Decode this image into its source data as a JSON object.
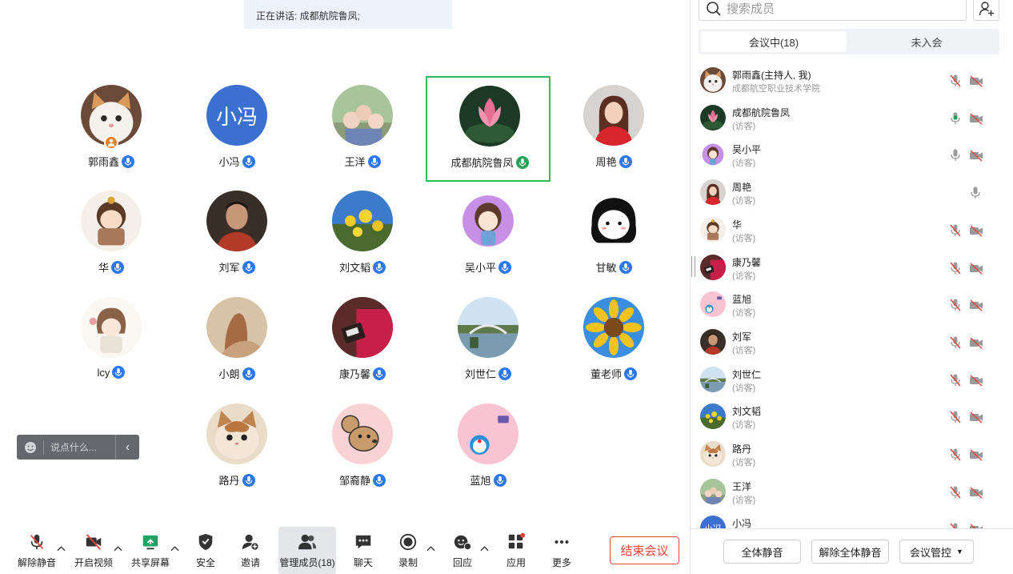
{
  "speaking_banner": "正在讲话: 成都航院鲁凤;",
  "grid": [
    {
      "name": "郭雨鑫",
      "avatar": "cat-avatar",
      "host": true,
      "mic": "blue"
    },
    {
      "name": "小冯",
      "avatar": "text-avatar",
      "avatar_text": "小冯",
      "mic": "blue"
    },
    {
      "name": "王洋",
      "avatar": "family-photo-avatar",
      "mic": "blue"
    },
    {
      "name": "成都航院鲁凤",
      "avatar": "lotus-avatar",
      "mic": "green",
      "active": true
    },
    {
      "name": "周艳",
      "avatar": "woman-red-avatar",
      "mic": "blue"
    },
    {
      "name": "华",
      "avatar": "cartoon-girl-avatar",
      "mic": "blue"
    },
    {
      "name": "刘军",
      "avatar": "man-portrait-avatar",
      "mic": "blue"
    },
    {
      "name": "刘文韬",
      "avatar": "yellow-flowers-avatar",
      "mic": "blue"
    },
    {
      "name": "吴小平",
      "avatar": "purple-girl-avatar",
      "mic": "blue"
    },
    {
      "name": "甘敏",
      "avatar": "black-hair-face-avatar",
      "mic": "blue"
    },
    {
      "name": "lcy",
      "avatar": "sketch-girl-avatar",
      "mic": "blue"
    },
    {
      "name": "小朗",
      "avatar": "sand-hand-avatar",
      "mic": "blue"
    },
    {
      "name": "康乃馨",
      "avatar": "red-bag-avatar",
      "mic": "blue"
    },
    {
      "name": "刘世仁",
      "avatar": "bridge-landscape-avatar",
      "mic": "blue"
    },
    {
      "name": "董老师",
      "avatar": "sunflower-avatar",
      "mic": "blue"
    },
    {
      "name": "路丹",
      "avatar": "kitten-avatar",
      "mic": "blue"
    },
    {
      "name": "邹裔静",
      "avatar": "cartoon-mouse-avatar",
      "mic": "blue"
    },
    {
      "name": "蓝旭",
      "avatar": "doraemon-avatar",
      "mic": "blue"
    }
  ],
  "chat_placeholder": "说点什么...",
  "toolbar": [
    {
      "label": "解除静音",
      "icon": "mic-muted-icon",
      "caret": true
    },
    {
      "label": "开启视频",
      "icon": "camera-off-icon",
      "caret": true
    },
    {
      "label": "共享屏幕",
      "icon": "share-screen-icon",
      "caret": true
    },
    {
      "label": "安全",
      "icon": "shield-icon"
    },
    {
      "label": "邀请",
      "icon": "invite-icon"
    },
    {
      "label": "管理成员(18)",
      "icon": "members-icon",
      "selected": true
    },
    {
      "label": "聊天",
      "icon": "chat-icon"
    },
    {
      "label": "录制",
      "icon": "record-icon",
      "caret": true
    },
    {
      "label": "回应",
      "icon": "reaction-icon",
      "caret": true
    },
    {
      "label": "应用",
      "icon": "apps-icon"
    },
    {
      "label": "更多",
      "icon": "more-icon"
    }
  ],
  "end_meeting": "结束会议",
  "panel": {
    "search_placeholder": "搜索成员",
    "tab_in": "会议中(18)",
    "tab_out": "未入会",
    "members": [
      {
        "name": "郭雨鑫(主持人, 我)",
        "sub": "成都航空职业技术学院",
        "avatar": "cat-avatar",
        "mic": "muted",
        "cam": "off"
      },
      {
        "name": "成都航院鲁凤",
        "sub": "(访客)",
        "avatar": "lotus-avatar",
        "mic": "speaking",
        "cam": "off"
      },
      {
        "name": "吴小平",
        "sub": "(访客)",
        "avatar": "purple-girl-avatar",
        "mic": "on",
        "cam": "off"
      },
      {
        "name": "周艳",
        "sub": "(访客)",
        "avatar": "woman-red-avatar",
        "mic": "on",
        "cam": "none"
      },
      {
        "name": "华",
        "sub": "(访客)",
        "avatar": "cartoon-girl-avatar",
        "mic": "muted",
        "cam": "off"
      },
      {
        "name": "康乃馨",
        "sub": "(访客)",
        "avatar": "red-bag-avatar",
        "mic": "muted",
        "cam": "off"
      },
      {
        "name": "蓝旭",
        "sub": "(访客)",
        "avatar": "doraemon-avatar",
        "mic": "muted",
        "cam": "off"
      },
      {
        "name": "刘军",
        "sub": "(访客)",
        "avatar": "man-portrait-avatar",
        "mic": "muted",
        "cam": "off"
      },
      {
        "name": "刘世仁",
        "sub": "(访客)",
        "avatar": "bridge-landscape-avatar",
        "mic": "muted",
        "cam": "off"
      },
      {
        "name": "刘文韬",
        "sub": "(访客)",
        "avatar": "yellow-flowers-avatar",
        "mic": "muted",
        "cam": "off"
      },
      {
        "name": "路丹",
        "sub": "(访客)",
        "avatar": "kitten-avatar",
        "mic": "muted",
        "cam": "off"
      },
      {
        "name": "王洋",
        "sub": "(访客)",
        "avatar": "family-photo-avatar",
        "mic": "muted",
        "cam": "off"
      },
      {
        "name": "小冯",
        "sub": "",
        "avatar": "text-avatar",
        "avatar_text": "小冯",
        "mic": "muted",
        "cam": "off"
      }
    ],
    "btn_mute_all": "全体静音",
    "btn_unmute_all": "解除全体静音",
    "btn_control": "会议管控"
  },
  "colors": {
    "accent": "#2b78f0",
    "speaking": "#23a357",
    "danger": "#e2463d",
    "active_border": "#2dbc5d"
  }
}
